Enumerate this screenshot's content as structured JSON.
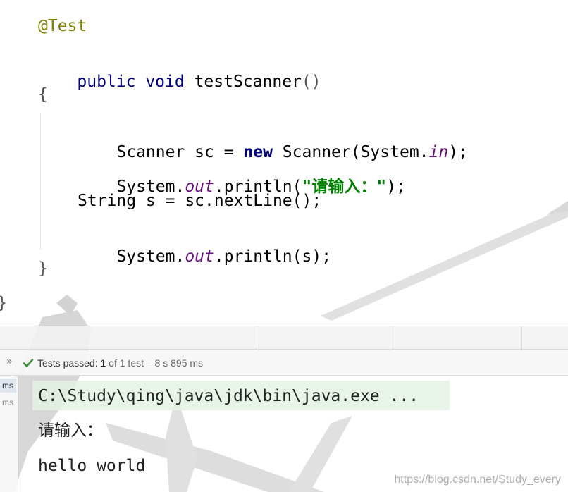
{
  "editor": {
    "annotation": "@Test",
    "method_modifiers": "public void",
    "method_name": " testScanner",
    "method_parens": "()",
    "open_brace": "{",
    "close_brace_method": "}",
    "close_brace_class": "}",
    "lines": {
      "l1_type": "Scanner sc = ",
      "l1_new": "new",
      "l1_call": " Scanner(System.",
      "l1_field": "in",
      "l1_end": ");",
      "l2_start": "System.",
      "l2_field": "out",
      "l2_call": ".println(",
      "l2_str": "\"请输入：\"",
      "l2_end": ");",
      "l3": "String s = sc.nextLine();",
      "l4_start": "System.",
      "l4_field": "out",
      "l4_end": ".println(s);"
    }
  },
  "test_status": {
    "expand_toggle": "»",
    "label": "Tests passed: ",
    "count": "1",
    "rest": " of 1 test – 8 s 895 ms",
    "pass_color": "#3d8f3d"
  },
  "test_gutter": {
    "items": [
      "ms",
      "ms"
    ]
  },
  "console": {
    "command": "C:\\Study\\qing\\java\\jdk\\bin\\java.exe ...",
    "prompt": "请输入：",
    "input": "hello world"
  },
  "watermark": "https://blog.csdn.net/Study_every"
}
